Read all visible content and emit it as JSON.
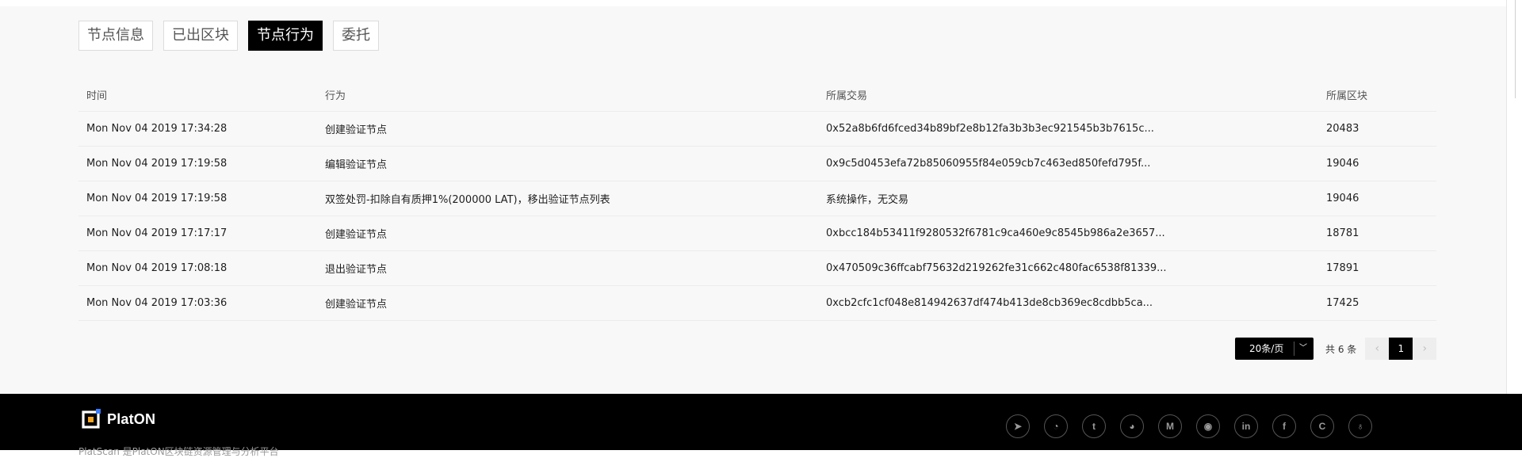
{
  "tabs": [
    {
      "label": "节点信息",
      "active": false
    },
    {
      "label": "已出区块",
      "active": false
    },
    {
      "label": "节点行为",
      "active": true
    },
    {
      "label": "委托",
      "active": false
    }
  ],
  "table": {
    "headers": [
      "时间",
      "行为",
      "所属交易",
      "所属区块"
    ],
    "rows": [
      {
        "time": "Mon Nov 04 2019 17:34:28",
        "action": "创建验证节点",
        "tx": "0x52a8b6fd6fced34b89bf2e8b12fa3b3b3ec921545b3b7615c...",
        "tx_is_link": true,
        "block": "20483"
      },
      {
        "time": "Mon Nov 04 2019 17:19:58",
        "action": "编辑验证节点",
        "tx": "0x9c5d0453efa72b85060955f84e059cb7c463ed850fefd795f...",
        "tx_is_link": true,
        "block": "19046"
      },
      {
        "time": "Mon Nov 04 2019 17:19:58",
        "action": "双签处罚-扣除自有质押1%(200000 LAT)，移出验证节点列表",
        "tx": "系统操作，无交易",
        "tx_is_link": false,
        "block": "19046"
      },
      {
        "time": "Mon Nov 04 2019 17:17:17",
        "action": "创建验证节点",
        "tx": "0xbcc184b53411f9280532f6781c9ca460e9c8545b986a2e3657...",
        "tx_is_link": true,
        "block": "18781"
      },
      {
        "time": "Mon Nov 04 2019 17:08:18",
        "action": "退出验证节点",
        "tx": "0x470509c36ffcabf75632d219262fe31c662c480fac6538f81339...",
        "tx_is_link": true,
        "block": "17891"
      },
      {
        "time": "Mon Nov 04 2019 17:03:36",
        "action": "创建验证节点",
        "tx": "0xcb2cfc1cf048e814942637df474b413de8cb369ec8cdbb5ca...",
        "tx_is_link": true,
        "block": "17425"
      }
    ]
  },
  "pagination": {
    "page_size": "20条/页",
    "total": "共 6 条",
    "prev": "‹",
    "next": "›",
    "current": "1"
  },
  "footer": {
    "logo_text": "PlatON",
    "description": "PlatScan 是PlatON区块链资源管理与分析平台",
    "socials": [
      {
        "icon": "telegram-icon",
        "glyph": "➤"
      },
      {
        "icon": "wechat-icon",
        "glyph": "◔"
      },
      {
        "icon": "twitter-icon",
        "glyph": "t"
      },
      {
        "icon": "reddit-icon",
        "glyph": "◕"
      },
      {
        "icon": "medium-icon",
        "glyph": "M"
      },
      {
        "icon": "github-icon",
        "glyph": "◉"
      },
      {
        "icon": "linkedin-icon",
        "glyph": "in"
      },
      {
        "icon": "facebook-icon",
        "glyph": "f"
      },
      {
        "icon": "coinmarketcap-icon",
        "glyph": "C"
      },
      {
        "icon": "support-icon",
        "glyph": "♁"
      }
    ]
  },
  "colors": {
    "link": "#2e8ad8",
    "active_tab": "#000000",
    "background": "#f8f8f8",
    "footer": "#000000"
  }
}
